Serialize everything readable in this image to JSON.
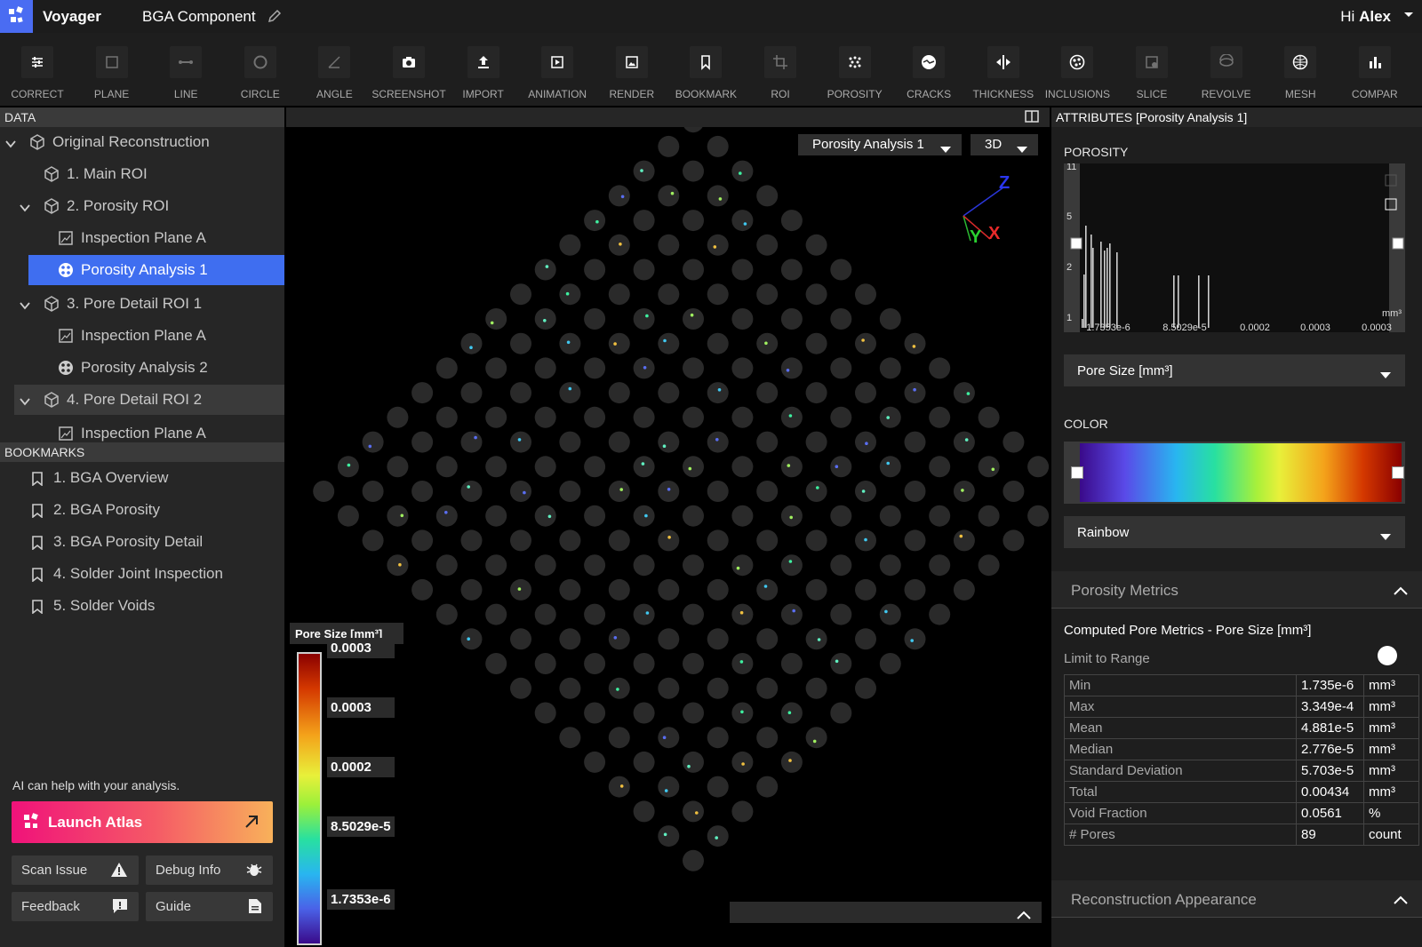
{
  "app": {
    "name": "Voyager",
    "project": "BGA Component",
    "greeting_prefix": "Hi",
    "user": "Alex"
  },
  "toolbar": [
    {
      "label": "CORRECT",
      "icon": "sliders-icon",
      "dim": false
    },
    {
      "label": "PLANE",
      "icon": "plane-icon",
      "dim": true
    },
    {
      "label": "LINE",
      "icon": "line-icon",
      "dim": true
    },
    {
      "label": "CIRCLE",
      "icon": "circle-icon",
      "dim": true
    },
    {
      "label": "ANGLE",
      "icon": "angle-icon",
      "dim": true
    },
    {
      "label": "SCREENSHOT",
      "icon": "camera-icon",
      "dim": false
    },
    {
      "label": "IMPORT",
      "icon": "upload-icon",
      "dim": false
    },
    {
      "label": "ANIMATION",
      "icon": "play-icon",
      "dim": false
    },
    {
      "label": "RENDER",
      "icon": "image-icon",
      "dim": false
    },
    {
      "label": "BOOKMARK",
      "icon": "bookmark-icon",
      "dim": false
    },
    {
      "label": "ROI",
      "icon": "crop-icon",
      "dim": true
    },
    {
      "label": "POROSITY",
      "icon": "porosity-icon",
      "dim": false
    },
    {
      "label": "CRACKS",
      "icon": "cracks-icon",
      "dim": false
    },
    {
      "label": "THICKNESS",
      "icon": "thickness-icon",
      "dim": false
    },
    {
      "label": "INCLUSIONS",
      "icon": "inclusions-icon",
      "dim": false
    },
    {
      "label": "SLICE",
      "icon": "slice-icon",
      "dim": true
    },
    {
      "label": "REVOLVE",
      "icon": "revolve-icon",
      "dim": true
    },
    {
      "label": "MESH",
      "icon": "mesh-icon",
      "dim": false
    },
    {
      "label": "COMPAR",
      "icon": "compare-icon",
      "dim": false
    }
  ],
  "data_panel": {
    "title": "DATA",
    "tree": [
      {
        "label": "Original Reconstruction",
        "icon": "cube-icon",
        "level": 0,
        "expanded": true
      },
      {
        "label": "1. Main ROI",
        "icon": "cube-icon",
        "level": 1
      },
      {
        "label": "2. Porosity ROI",
        "icon": "cube-icon",
        "level": 1,
        "expanded": true
      },
      {
        "label": "Inspection Plane A",
        "icon": "plane-icon",
        "level": 2
      },
      {
        "label": "Porosity Analysis 1",
        "icon": "porosity-icon",
        "level": 2,
        "selected": true
      },
      {
        "label": "3. Pore Detail ROI 1",
        "icon": "cube-icon",
        "level": 1,
        "expanded": true
      },
      {
        "label": "Inspection Plane A",
        "icon": "plane-icon",
        "level": 2
      },
      {
        "label": "Porosity Analysis 2",
        "icon": "porosity-icon",
        "level": 2
      },
      {
        "label": "4. Pore Detail ROI 2",
        "icon": "cube-icon",
        "level": 1,
        "expanded": true,
        "highlighted": true
      },
      {
        "label": "Inspection Plane A",
        "icon": "plane-icon",
        "level": 2
      }
    ]
  },
  "bookmarks": {
    "title": "BOOKMARKS",
    "items": [
      "1. BGA Overview",
      "2. BGA Porosity",
      "3. BGA Porosity Detail",
      "4. Solder Joint Inspection",
      "5. Solder Voids"
    ]
  },
  "assistant": {
    "hint": "AI can help with your analysis.",
    "launch_label": "Launch Atlas",
    "scan_issue": "Scan Issue",
    "debug_info": "Debug Info",
    "feedback": "Feedback",
    "guide": "Guide"
  },
  "viewport": {
    "analysis_select": "Porosity Analysis 1",
    "view_mode": "3D",
    "axes": {
      "x": "X",
      "y": "Y",
      "z": "Z"
    },
    "legend": {
      "title": "Pore Size [mm³]",
      "labels": [
        "0.0003",
        "0.0003",
        "0.0002",
        "8.5029e-5",
        "1.7353e-6"
      ]
    }
  },
  "attributes": {
    "title": "ATTRIBUTES [Porosity Analysis 1]",
    "porosity_label": "POROSITY",
    "histogram": {
      "y_ticks": [
        "11",
        "5",
        "2",
        "1"
      ],
      "x_ticks": [
        "1.7353e-6",
        "8.5029e-5",
        "0.0002",
        "0.0003",
        "0.0003"
      ],
      "unit": "mm³"
    },
    "attribute_select": "Pore Size [mm³]",
    "color_label": "COLOR",
    "colormap_select": "Rainbow",
    "colors": {
      "accent": "#3f6ef0",
      "brand": "#4a6cf2"
    }
  },
  "metrics": {
    "section_title": "Porosity Metrics",
    "computed_title": "Computed Pore Metrics - Pore Size [mm³]",
    "limit_label": "Limit to Range",
    "limit_enabled": false,
    "rows": [
      {
        "name": "Min",
        "value": "1.735e-6",
        "unit": "mm³"
      },
      {
        "name": "Max",
        "value": "3.349e-4",
        "unit": "mm³"
      },
      {
        "name": "Mean",
        "value": "4.881e-5",
        "unit": "mm³"
      },
      {
        "name": "Median",
        "value": "2.776e-5",
        "unit": "mm³"
      },
      {
        "name": "Standard Deviation",
        "value": "5.703e-5",
        "unit": "mm³"
      },
      {
        "name": "Total",
        "value": "0.00434",
        "unit": "mm³"
      },
      {
        "name": "Void Fraction",
        "value": "0.0561",
        "unit": "%"
      },
      {
        "name": "# Pores",
        "value": "89",
        "unit": "count"
      }
    ]
  },
  "reconstruction": {
    "section_title": "Reconstruction Appearance"
  }
}
